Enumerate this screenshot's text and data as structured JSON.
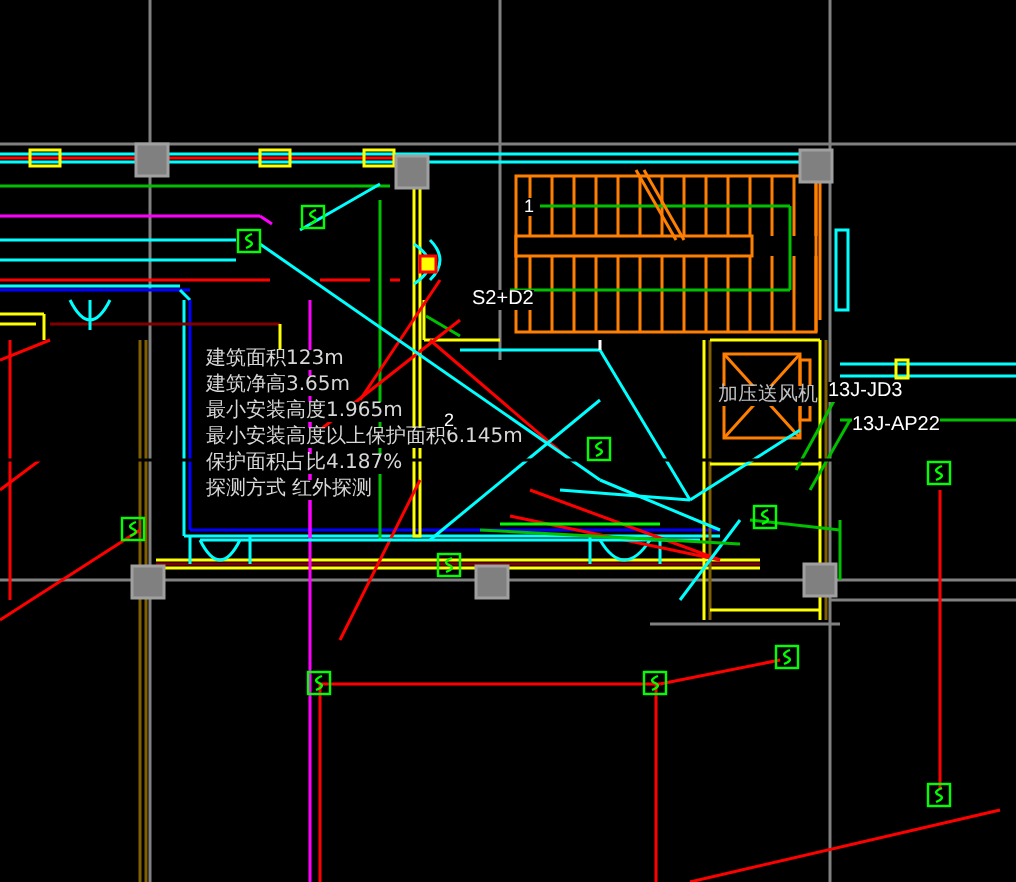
{
  "drawing_notes": [
    {
      "text": "建筑面积123m"
    },
    {
      "text": "建筑净高3.65m"
    },
    {
      "text": "最小安装高度1.965m"
    },
    {
      "text": "最小安装高度以上保护面积6.145m"
    },
    {
      "text": "保护面积占比4.187%"
    },
    {
      "text": "探测方式 红外探测"
    }
  ],
  "labels": [
    {
      "text": "S2+D2"
    },
    {
      "text": "1"
    },
    {
      "text": "2"
    },
    {
      "text": "13J-JD3"
    },
    {
      "text": "13J-AP22"
    },
    {
      "text": "加压送风机"
    }
  ]
}
